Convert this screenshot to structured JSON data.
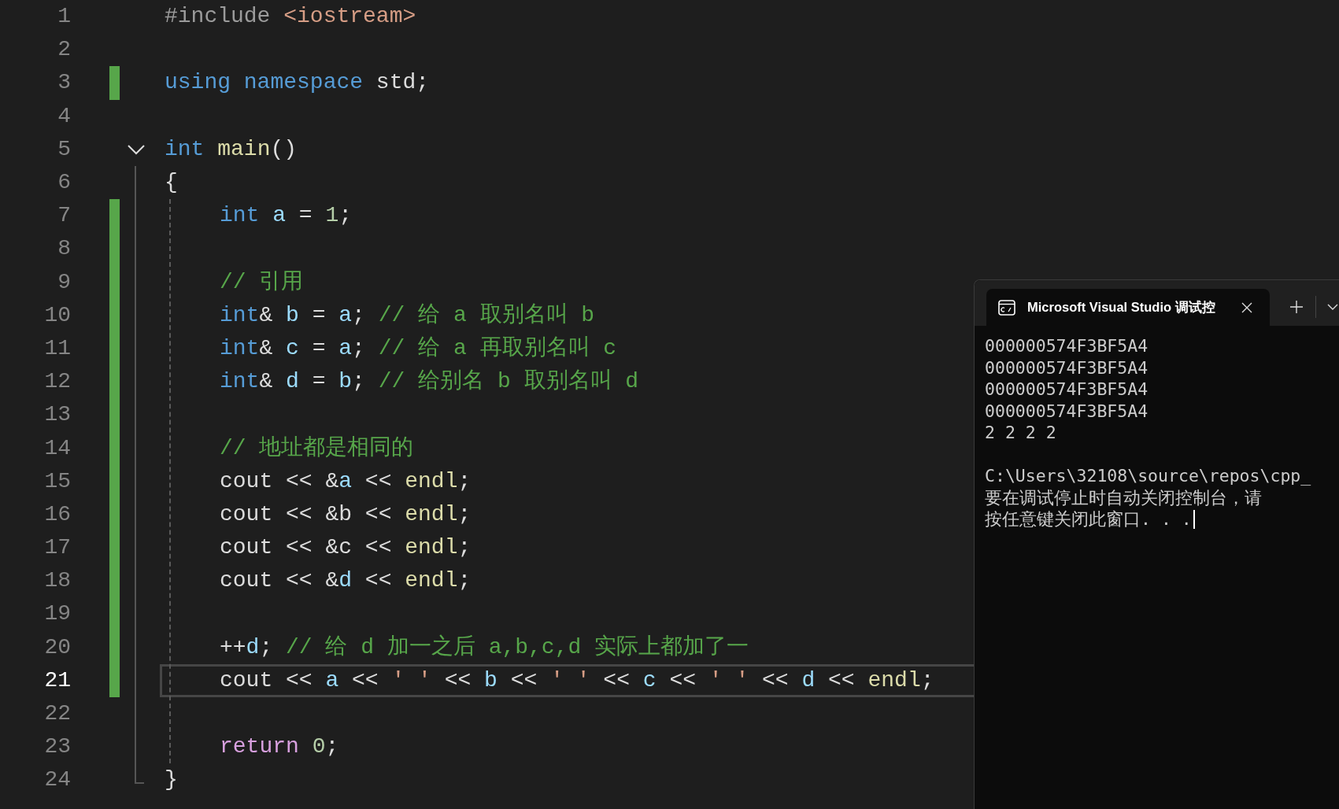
{
  "editor": {
    "lines": [
      {
        "number": "1",
        "tokens": [
          {
            "text": "#include ",
            "kind": "pre"
          },
          {
            "text": "<iostream>",
            "kind": "str"
          }
        ]
      },
      {
        "number": "2"
      },
      {
        "number": "3",
        "changed": true,
        "tokens": [
          {
            "text": "using namespace",
            "kind": "kw"
          },
          {
            "text": " std;",
            "kind": "plain"
          }
        ]
      },
      {
        "number": "4"
      },
      {
        "number": "5",
        "expanded": true,
        "tokens": [
          {
            "text": "int ",
            "kind": "kw"
          },
          {
            "text": "main",
            "kind": "fn"
          },
          {
            "text": "()",
            "kind": "plain"
          }
        ],
        "children": [
          {
            "number": "6",
            "tokens": [
              {
                "text": "{",
                "kind": "plain"
              }
            ],
            "children": [
              {
                "number": "7",
                "changed": true,
                "tokens": [
                  {
                    "text": "int ",
                    "kind": "kw"
                  },
                  {
                    "text": "a",
                    "kind": "var"
                  },
                  {
                    "text": " = ",
                    "kind": "plain"
                  },
                  {
                    "text": "1",
                    "kind": "num"
                  },
                  {
                    "text": ";",
                    "kind": "plain"
                  }
                ]
              },
              {
                "number": "8",
                "changed": true
              },
              {
                "number": "9",
                "changed": true,
                "tokens": [
                  {
                    "text": "// 引用",
                    "kind": "cm"
                  }
                ]
              },
              {
                "number": "10",
                "changed": true,
                "tokens": [
                  {
                    "text": "int",
                    "kind": "kw"
                  },
                  {
                    "text": "& ",
                    "kind": "plain"
                  },
                  {
                    "text": "b",
                    "kind": "var"
                  },
                  {
                    "text": " = ",
                    "kind": "plain"
                  },
                  {
                    "text": "a",
                    "kind": "var"
                  },
                  {
                    "text": "; ",
                    "kind": "plain"
                  },
                  {
                    "text": "// 给 a 取别名叫 b",
                    "kind": "cm"
                  }
                ]
              },
              {
                "number": "11",
                "changed": true,
                "tokens": [
                  {
                    "text": "int",
                    "kind": "kw"
                  },
                  {
                    "text": "& ",
                    "kind": "plain"
                  },
                  {
                    "text": "c",
                    "kind": "var"
                  },
                  {
                    "text": " = ",
                    "kind": "plain"
                  },
                  {
                    "text": "a",
                    "kind": "var"
                  },
                  {
                    "text": "; ",
                    "kind": "plain"
                  },
                  {
                    "text": "// 给 a 再取别名叫 c",
                    "kind": "cm"
                  }
                ]
              },
              {
                "number": "12",
                "changed": true,
                "tokens": [
                  {
                    "text": "int",
                    "kind": "kw"
                  },
                  {
                    "text": "& ",
                    "kind": "plain"
                  },
                  {
                    "text": "d",
                    "kind": "var"
                  },
                  {
                    "text": " = ",
                    "kind": "plain"
                  },
                  {
                    "text": "b",
                    "kind": "var"
                  },
                  {
                    "text": "; ",
                    "kind": "plain"
                  },
                  {
                    "text": "// 给别名 b 取别名叫 d",
                    "kind": "cm"
                  }
                ]
              },
              {
                "number": "13",
                "changed": true
              },
              {
                "number": "14",
                "changed": true,
                "tokens": [
                  {
                    "text": "// 地址都是相同的",
                    "kind": "cm"
                  }
                ]
              },
              {
                "number": "15",
                "changed": true,
                "tokens": [
                  {
                    "text": "cout << &",
                    "kind": "plain"
                  },
                  {
                    "text": "a",
                    "kind": "var"
                  },
                  {
                    "text": " << ",
                    "kind": "plain"
                  },
                  {
                    "text": "endl",
                    "kind": "fn"
                  },
                  {
                    "text": ";",
                    "kind": "plain"
                  }
                ]
              },
              {
                "number": "16",
                "changed": true,
                "tokens": [
                  {
                    "text": "cout << &b << ",
                    "kind": "plain"
                  },
                  {
                    "text": "endl",
                    "kind": "fn"
                  },
                  {
                    "text": ";",
                    "kind": "plain"
                  }
                ]
              },
              {
                "number": "17",
                "changed": true,
                "tokens": [
                  {
                    "text": "cout << &c << ",
                    "kind": "plain"
                  },
                  {
                    "text": "endl",
                    "kind": "fn"
                  },
                  {
                    "text": ";",
                    "kind": "plain"
                  }
                ]
              },
              {
                "number": "18",
                "changed": true,
                "tokens": [
                  {
                    "text": "cout << &",
                    "kind": "plain"
                  },
                  {
                    "text": "d",
                    "kind": "var"
                  },
                  {
                    "text": " << ",
                    "kind": "plain"
                  },
                  {
                    "text": "endl",
                    "kind": "fn"
                  },
                  {
                    "text": ";",
                    "kind": "plain"
                  }
                ]
              },
              {
                "number": "19",
                "changed": true
              },
              {
                "number": "20",
                "changed": true,
                "tokens": [
                  {
                    "text": "++",
                    "kind": "plain"
                  },
                  {
                    "text": "d",
                    "kind": "var"
                  },
                  {
                    "text": "; ",
                    "kind": "plain"
                  },
                  {
                    "text": "// 给 d 加一之后 a,b,c,d 实际上都加了一",
                    "kind": "cm"
                  }
                ]
              },
              {
                "number": "21",
                "changed": true,
                "current": true,
                "tokens": [
                  {
                    "text": "cout << ",
                    "kind": "plain"
                  },
                  {
                    "text": "a",
                    "kind": "var"
                  },
                  {
                    "text": " << ",
                    "kind": "plain"
                  },
                  {
                    "text": "' '",
                    "kind": "str"
                  },
                  {
                    "text": " << ",
                    "kind": "plain"
                  },
                  {
                    "text": "b",
                    "kind": "var"
                  },
                  {
                    "text": " << ",
                    "kind": "plain"
                  },
                  {
                    "text": "' '",
                    "kind": "str"
                  },
                  {
                    "text": " << ",
                    "kind": "plain"
                  },
                  {
                    "text": "c",
                    "kind": "var"
                  },
                  {
                    "text": " << ",
                    "kind": "plain"
                  },
                  {
                    "text": "' '",
                    "kind": "str"
                  },
                  {
                    "text": " << ",
                    "kind": "plain"
                  },
                  {
                    "text": "d",
                    "kind": "var"
                  },
                  {
                    "text": " << ",
                    "kind": "plain"
                  },
                  {
                    "text": "endl",
                    "kind": "fn"
                  },
                  {
                    "text": ";",
                    "kind": "plain"
                  }
                ]
              },
              {
                "number": "22"
              },
              {
                "number": "23",
                "tokens": [
                  {
                    "text": "return ",
                    "kind": "ctl"
                  },
                  {
                    "text": "0",
                    "kind": "num"
                  },
                  {
                    "text": ";",
                    "kind": "plain"
                  }
                ]
              }
            ]
          },
          {
            "number": "24",
            "tokens": [
              {
                "text": "}",
                "kind": "plain"
              }
            ]
          }
        ]
      }
    ]
  },
  "console": {
    "tab_title": "Microsoft Visual Studio 调试控",
    "output_lines": [
      "000000574F3BF5A4",
      "000000574F3BF5A4",
      "000000574F3BF5A4",
      "000000574F3BF5A4",
      "2 2 2 2",
      "C:\\Users\\32108\\source\\repos\\cpp_",
      "要在调试停止时自动关闭控制台，请",
      "按任意键关闭此窗口. . ."
    ],
    "cursor": true
  }
}
